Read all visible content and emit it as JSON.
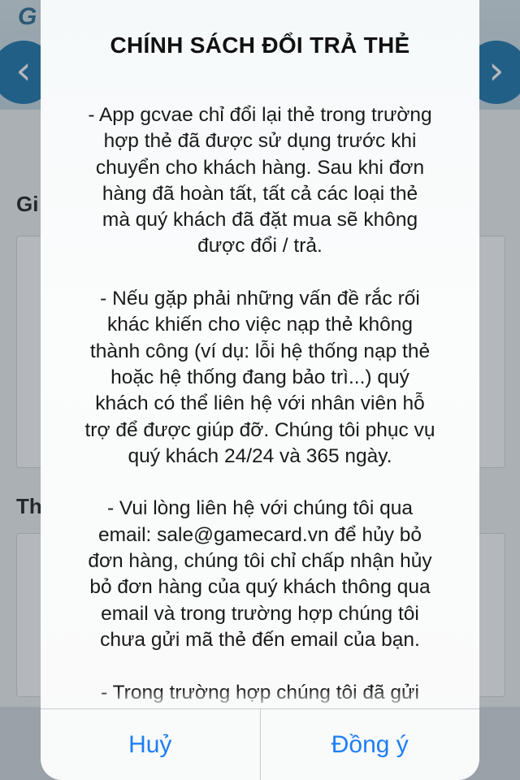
{
  "background": {
    "logo_letter": "G",
    "nav_prev_glyph": "‹",
    "nav_next_glyph": "›",
    "section1_heading": "Gi",
    "section2_heading": "Th"
  },
  "dialog": {
    "title": "CHÍNH SÁCH ĐỔI TRẢ THẺ",
    "paragraphs": [
      "- App gcvae chỉ đổi lại thẻ trong trường\nhợp thẻ đã được sử dụng trước khi\nchuyển cho khách hàng. Sau khi đơn\nhàng đã hoàn tất, tất cả các loại thẻ\nmà quý khách đã đặt mua sẽ không\nđược đổi / trả.",
      "- Nếu gặp phải những vấn đề rắc rối\nkhác khiến cho việc nạp thẻ không\nthành công (ví dụ: lỗi hệ thống nạp thẻ\nhoặc hệ thống đang bảo trì...) quý\nkhách có thể liên hệ với nhân viên hỗ\ntrợ để được giúp đỡ. Chúng tôi phục vụ\nquý khách 24/24 và 365 ngày.",
      "- Vui lòng liên hệ với chúng tôi qua\nemail: sale@gamecard.vn để hủy bỏ\nđơn hàng, chúng tôi chỉ chấp nhận hủy\nbỏ đơn hàng của quý khách thông qua\nemail và trong trường hợp chúng tôi\nchưa gửi mã thẻ đến email của bạn.",
      "- Trong trường hợp chúng tôi đã gửi"
    ],
    "cancel_label": "Huỷ",
    "confirm_label": "Đồng ý",
    "accent_color": "#1e7ef5"
  }
}
